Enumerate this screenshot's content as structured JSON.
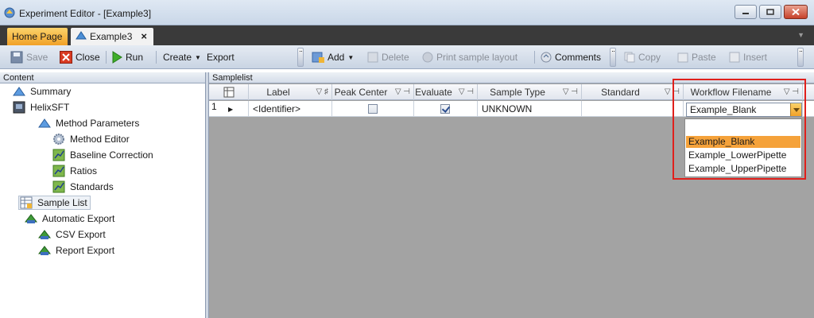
{
  "window": {
    "title": "Experiment Editor - [Example3]"
  },
  "tabs": {
    "home": "Home Page",
    "doc": "Example3",
    "close_glyph": "×"
  },
  "toolbar": {
    "save": "Save",
    "close": "Close",
    "run": "Run",
    "create": "Create",
    "export": "Export",
    "add": "Add",
    "delete": "Delete",
    "print": "Print sample layout",
    "comments": "Comments",
    "copy": "Copy",
    "paste": "Paste",
    "insert": "Insert"
  },
  "content": {
    "header": "Content",
    "items": [
      "Summary",
      "HelixSFT",
      "Method Parameters",
      "Method Editor",
      "Baseline Correction",
      "Ratios",
      "Standards",
      "Sample List",
      "Automatic Export",
      "CSV Export",
      "Report Export"
    ]
  },
  "samplelist": {
    "header": "Samplelist",
    "columns": [
      "Label",
      "Peak Center",
      "Evaluate",
      "Sample Type",
      "Standard",
      "Workflow Filename"
    ],
    "row": {
      "number": "1",
      "label": "<Identifier>",
      "peak_center": false,
      "evaluate": true,
      "sample_type": "UNKNOWN",
      "standard": "",
      "workflow": "Example_Blank"
    },
    "workflow_options": [
      "Example_Blank",
      "Example_LowerPipette",
      "Example_UpperPipette"
    ]
  },
  "colors": {
    "accent": "#f5a23a",
    "highlight": "#e0201c"
  }
}
